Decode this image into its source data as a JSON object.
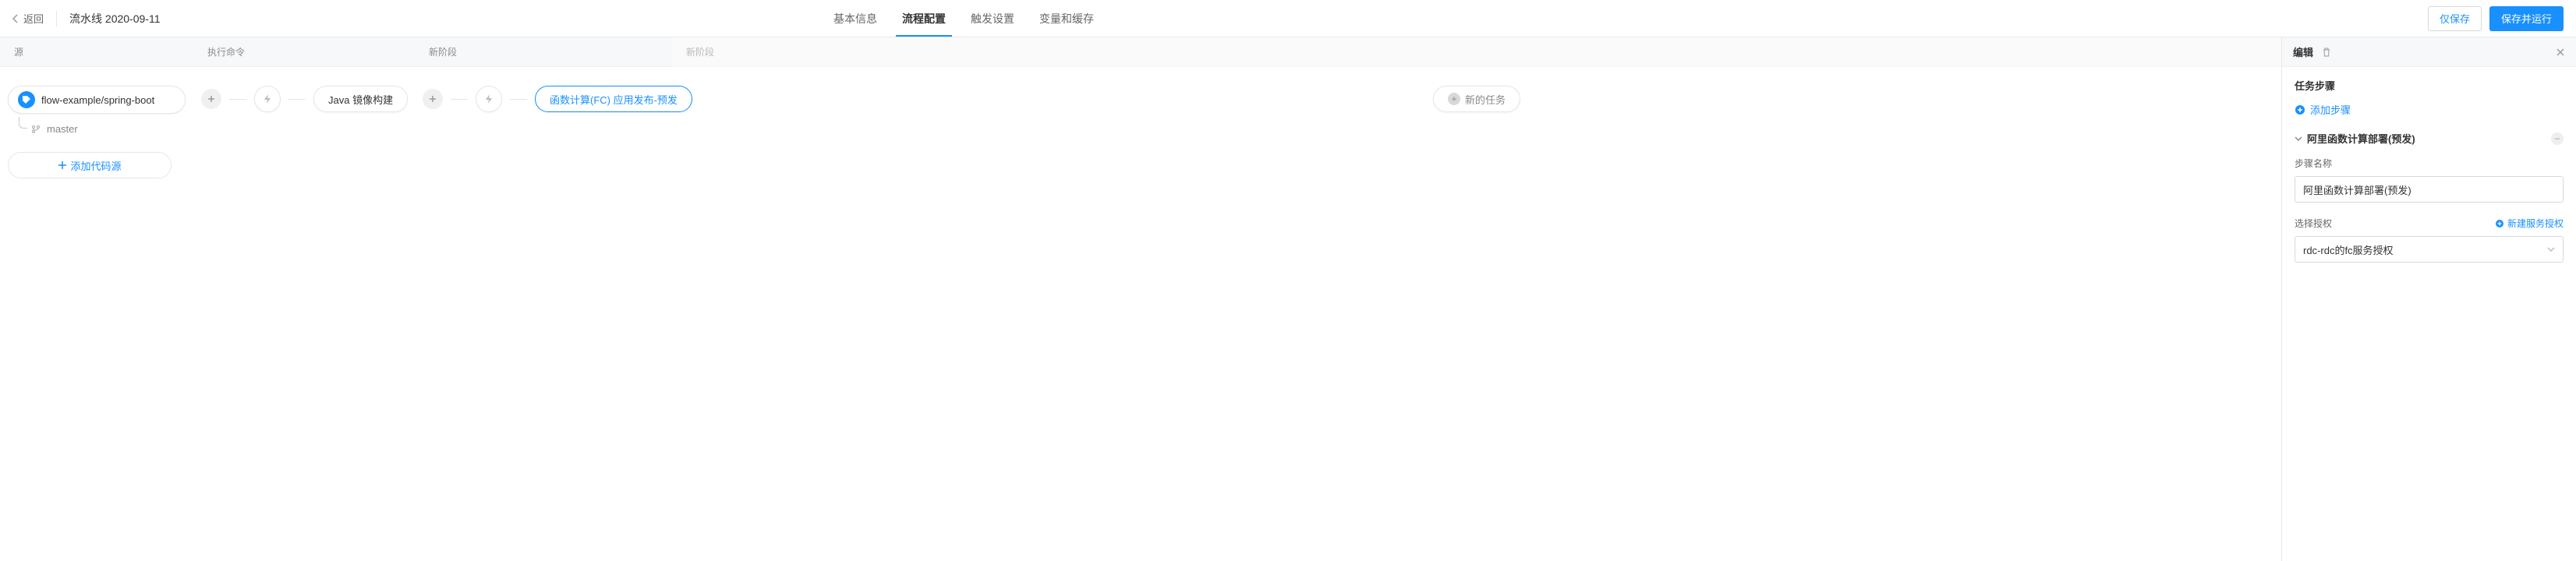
{
  "header": {
    "back": "返回",
    "title": "流水线 2020-09-11",
    "tabs": [
      "基本信息",
      "流程配置",
      "触发设置",
      "变量和缓存"
    ],
    "active_tab": 1,
    "save_only": "仅保存",
    "save_run": "保存并运行"
  },
  "stages": {
    "source_title": "源",
    "exec_title": "执行命令",
    "new_stage_title": "新阶段",
    "source_repo": "flow-example/spring-boot",
    "branch": "master",
    "add_source": "添加代码源",
    "task_java_mirror": "Java 镜像构建",
    "task_fc_release": "函数计算(FC) 应用发布-预发",
    "new_task": "新的任务"
  },
  "panel": {
    "title": "编辑",
    "section_task_steps": "任务步骤",
    "add_step": "添加步骤",
    "step": {
      "name": "阿里函数计算部署(预发)",
      "step_name_label": "步骤名称",
      "step_name_value": "阿里函数计算部署(预发)",
      "select_auth_label": "选择授权",
      "new_auth_link": "新建服务授权",
      "auth_value": "rdc-rdc的fc服务授权"
    }
  }
}
